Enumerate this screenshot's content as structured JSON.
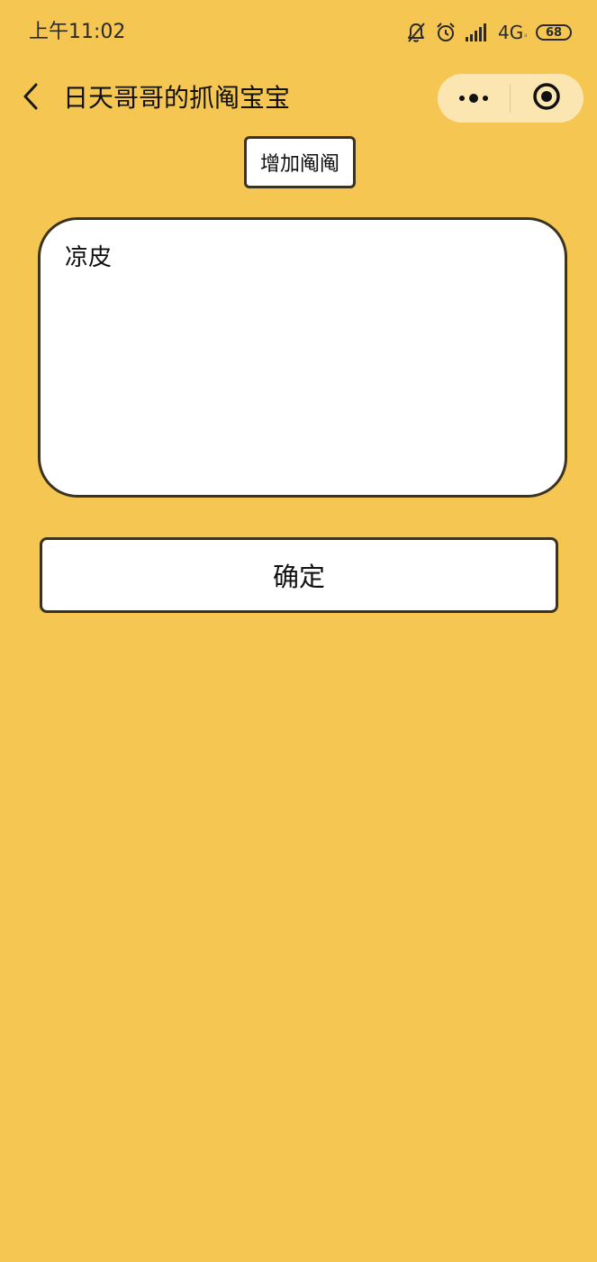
{
  "status_bar": {
    "time": "上午11:02",
    "network": "4G",
    "network_sub": "ᵢₗ",
    "battery": "68",
    "icons": [
      "bell-off-icon",
      "alarm-clock-icon",
      "signal-bars-icon",
      "battery-icon"
    ]
  },
  "nav": {
    "title": "日天哥哥的抓阄宝宝",
    "back_icon": "chevron-left-icon",
    "more_icon": "more-dots-icon",
    "close_icon": "target-close-icon"
  },
  "actions": {
    "add_label": "增加阄阄",
    "confirm_label": "确定"
  },
  "editor": {
    "value": "凉皮",
    "placeholder": ""
  },
  "colors": {
    "background": "#F5C752",
    "border": "#3a3320",
    "surface": "#FFFFFF"
  }
}
